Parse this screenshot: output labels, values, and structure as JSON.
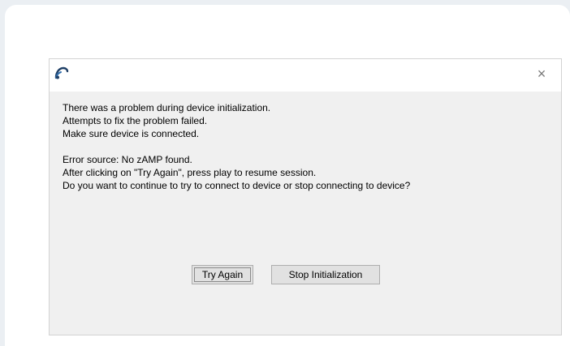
{
  "dialog": {
    "message_lines": [
      "There was a problem during device initialization.",
      "Attempts to fix the problem failed.",
      "Make sure device is connected."
    ],
    "error_source": "Error source: No zAMP found.",
    "instruction": "After clicking on \"Try Again\", press play to resume session.",
    "question": "Do you want to continue to try to connect to device or stop connecting to device?",
    "buttons": {
      "try_again": "Try Again",
      "stop_initialization": "Stop Initialization"
    },
    "close_glyph": "×",
    "icon": "app-logo-icon"
  },
  "colors": {
    "page_background": "#ebeff3",
    "dialog_background": "#f0f0f0",
    "button_background": "#e1e1e1"
  }
}
